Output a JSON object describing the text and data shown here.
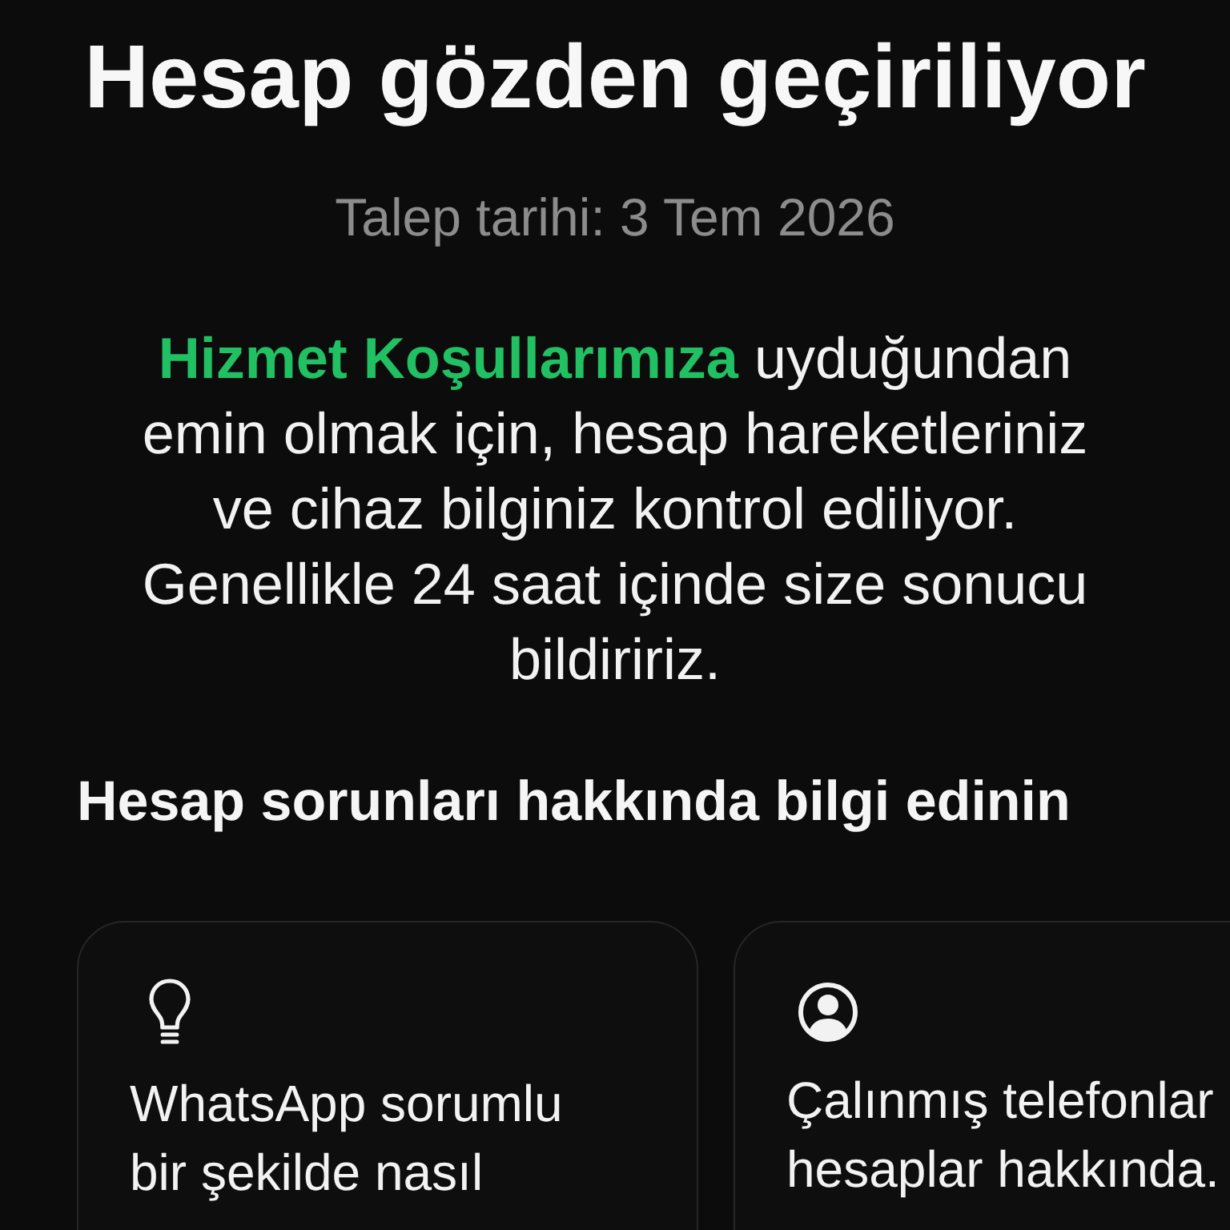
{
  "title": "Hesap gözden geçiriliyor",
  "request_date": "Talep tarihi: 3 Tem 2026",
  "description": {
    "link": "Hizmet Koşullarımıza",
    "text": "uyduğundan\nemin olmak için, hesap hareketleriniz\nve cihaz bilginiz kontrol ediliyor.\nGenellikle 24 saat içinde size sonucu\nbildiririz."
  },
  "help_section": {
    "heading": "Hesap sorunları hakkında bilgi edinin",
    "cards": [
      {
        "kind": "tip",
        "text": "WhatsApp sorumlu\nbir şekilde nasıl"
      },
      {
        "kind": "account",
        "text": "Çalınmış telefonlar\nhesaplar hakkında."
      }
    ]
  }
}
